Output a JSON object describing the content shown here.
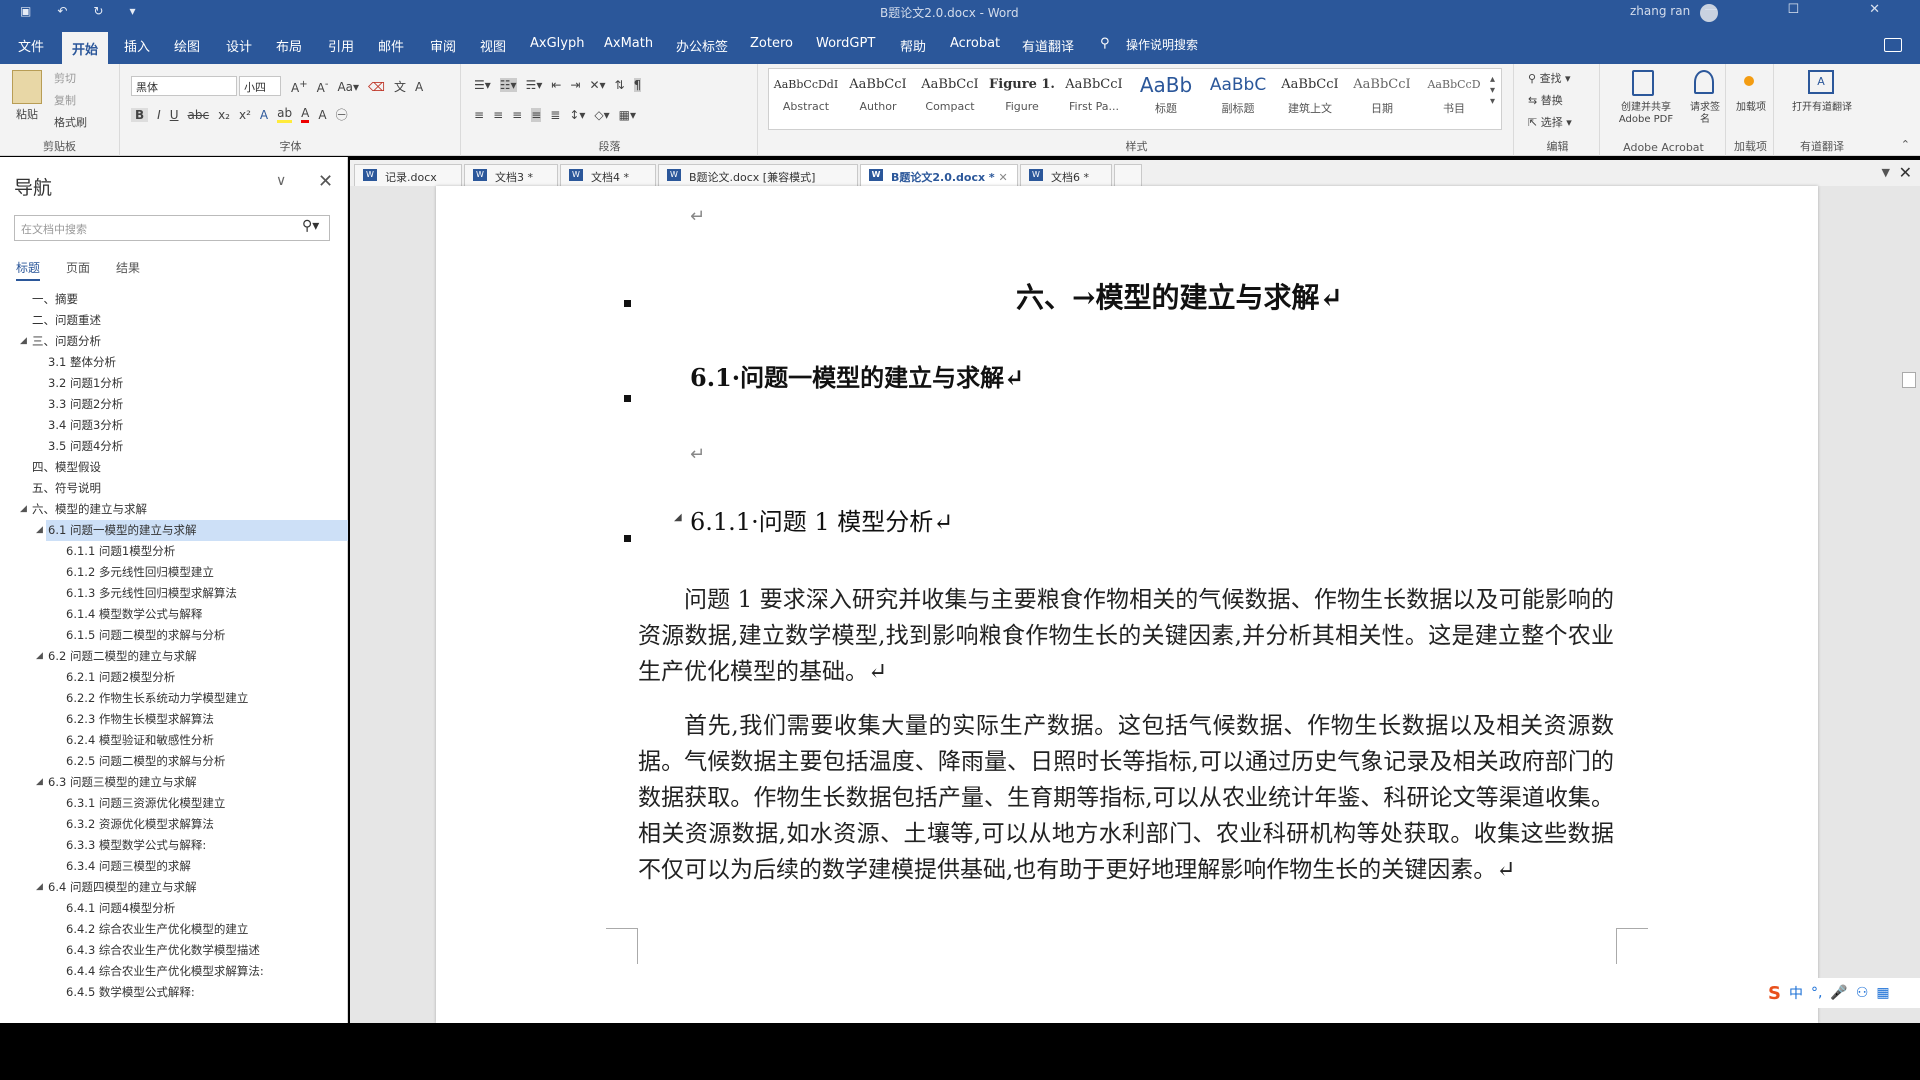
{
  "titlebar": {
    "doc_title": "B题论文2.0.docx - Word",
    "user": "zhang ran"
  },
  "menu": {
    "tabs": [
      "文件",
      "开始",
      "插入",
      "绘图",
      "设计",
      "布局",
      "引用",
      "邮件",
      "审阅",
      "视图",
      "AxGlyph",
      "AxMath",
      "办公标签",
      "Zotero",
      "WordGPT",
      "帮助",
      "Acrobat",
      "有道翻译",
      "操作说明搜索"
    ],
    "active": "开始"
  },
  "ribbon": {
    "clipboard": {
      "paste": "粘贴",
      "cut": "剪切",
      "copy": "复制",
      "format_painter": "格式刷",
      "label": "剪贴板"
    },
    "font": {
      "name": "黑体",
      "size": "小四",
      "label": "字体"
    },
    "paragraph": {
      "label": "段落"
    },
    "styles": {
      "label": "样式",
      "items": [
        {
          "preview": "AaBbCcDdI",
          "name": "Abstract"
        },
        {
          "preview": "AaBbCcI",
          "name": "Author"
        },
        {
          "preview": "AaBbCcI",
          "name": "Compact"
        },
        {
          "preview": "Figure 1.",
          "name": "Figure"
        },
        {
          "preview": "AaBbCcI",
          "name": "First Pa..."
        },
        {
          "preview": "AaBb",
          "name": "标题"
        },
        {
          "preview": "AaBbC",
          "name": "副标题"
        },
        {
          "preview": "AaBbCcI",
          "name": "建筑上文"
        },
        {
          "preview": "AaBbCcI",
          "name": "日期"
        },
        {
          "preview": "AaBbCcD",
          "name": "书目"
        }
      ]
    },
    "editing": {
      "find": "查找",
      "replace": "替换",
      "select": "选择",
      "label": "编辑"
    },
    "acrobat": {
      "create_share": "创建并共享 Adobe PDF",
      "request_sign": "请求签名",
      "label": "Adobe Acrobat"
    },
    "addins": {
      "btn": "加载项",
      "label": "加载项"
    },
    "youdao": {
      "btn": "打开有道翻译",
      "label": "有道翻译"
    }
  },
  "nav": {
    "title": "导航",
    "search_placeholder": "在文档中搜索",
    "tabs": [
      "标题",
      "页面",
      "结果"
    ],
    "outline": [
      {
        "text": "一、摘要",
        "level": 0,
        "toggle": ""
      },
      {
        "text": "二、问题重述",
        "level": 0,
        "toggle": ""
      },
      {
        "text": "三、问题分析",
        "level": 0,
        "toggle": "◢"
      },
      {
        "text": "3.1 整体分析",
        "level": 1,
        "toggle": ""
      },
      {
        "text": "3.2 问题1分析",
        "level": 1,
        "toggle": ""
      },
      {
        "text": "3.3 问题2分析",
        "level": 1,
        "toggle": ""
      },
      {
        "text": "3.4 问题3分析",
        "level": 1,
        "toggle": ""
      },
      {
        "text": "3.5 问题4分析",
        "level": 1,
        "toggle": ""
      },
      {
        "text": "四、模型假设",
        "level": 0,
        "toggle": ""
      },
      {
        "text": "五、符号说明",
        "level": 0,
        "toggle": ""
      },
      {
        "text": "六、模型的建立与求解",
        "level": 0,
        "toggle": "◢"
      },
      {
        "text": "6.1 问题一模型的建立与求解",
        "level": 1,
        "toggle": "◢",
        "selected": true
      },
      {
        "text": "6.1.1 问题1模型分析",
        "level": 2,
        "toggle": ""
      },
      {
        "text": "6.1.2 多元线性回归模型建立",
        "level": 2,
        "toggle": ""
      },
      {
        "text": "6.1.3 多元线性回归模型求解算法",
        "level": 2,
        "toggle": ""
      },
      {
        "text": "6.1.4 模型数学公式与解释",
        "level": 2,
        "toggle": ""
      },
      {
        "text": "6.1.5 问题二模型的求解与分析",
        "level": 2,
        "toggle": ""
      },
      {
        "text": "6.2 问题二模型的建立与求解",
        "level": 1,
        "toggle": "◢"
      },
      {
        "text": "6.2.1 问题2模型分析",
        "level": 2,
        "toggle": ""
      },
      {
        "text": "6.2.2 作物生长系统动力学模型建立",
        "level": 2,
        "toggle": ""
      },
      {
        "text": "6.2.3 作物生长模型求解算法",
        "level": 2,
        "toggle": ""
      },
      {
        "text": "6.2.4 模型验证和敏感性分析",
        "level": 2,
        "toggle": ""
      },
      {
        "text": "6.2.5 问题二模型的求解与分析",
        "level": 2,
        "toggle": ""
      },
      {
        "text": "6.3 问题三模型的建立与求解",
        "level": 1,
        "toggle": "◢"
      },
      {
        "text": "6.3.1 问题三资源优化模型建立",
        "level": 2,
        "toggle": ""
      },
      {
        "text": "6.3.2 资源优化模型求解算法",
        "level": 2,
        "toggle": ""
      },
      {
        "text": "6.3.3 模型数学公式与解释:",
        "level": 2,
        "toggle": ""
      },
      {
        "text": "6.3.4 问题三模型的求解",
        "level": 2,
        "toggle": ""
      },
      {
        "text": "6.4 问题四模型的建立与求解",
        "level": 1,
        "toggle": "◢"
      },
      {
        "text": "6.4.1 问题4模型分析",
        "level": 2,
        "toggle": ""
      },
      {
        "text": "6.4.2 综合农业生产优化模型的建立",
        "level": 2,
        "toggle": ""
      },
      {
        "text": "6.4.3 综合农业生产优化数学模型描述",
        "level": 2,
        "toggle": ""
      },
      {
        "text": "6.4.4 综合农业生产优化模型求解算法:",
        "level": 2,
        "toggle": ""
      },
      {
        "text": "6.4.5 数学模型公式解释:",
        "level": 2,
        "toggle": ""
      }
    ]
  },
  "doc_tabs": [
    {
      "label": "记录.docx",
      "active": false
    },
    {
      "label": "文档3 *",
      "active": false
    },
    {
      "label": "文档4 *",
      "active": false
    },
    {
      "label": "B题论文.docx [兼容模式]",
      "active": false
    },
    {
      "label": "B题论文2.0.docx *",
      "active": true
    },
    {
      "label": "文档6 *",
      "active": false
    }
  ],
  "document": {
    "h1": "六、→模型的建立与求解↵",
    "h2": "6.1·问题一模型的建立与求解↵",
    "h3": "6.1.1·问题 1 模型分析↵",
    "para_mark": "↵",
    "p1": "问题 1 要求深入研究并收集与主要粮食作物相关的气候数据、作物生长数据以及可能影响的资源数据,建立数学模型,找到影响粮食作物生长的关键因素,并分析其相关性。这是建立整个农业生产优化模型的基础。↵",
    "p2": "首先,我们需要收集大量的实际生产数据。这包括气候数据、作物生长数据以及相关资源数据。气候数据主要包括温度、降雨量、日照时长等指标,可以通过历史气象记录及相关政府部门的数据获取。作物生长数据包括产量、生育期等指标,可以从农业统计年鉴、科研论文等渠道收集。相关资源数据,如水资源、土壤等,可以从地方水利部门、农业科研机构等处获取。收集这些数据不仅可以为后续的数学建模提供基础,也有助于更好地理解影响作物生长的关键因素。↵"
  },
  "ime": {
    "lang": "中",
    "punct": "°,"
  }
}
